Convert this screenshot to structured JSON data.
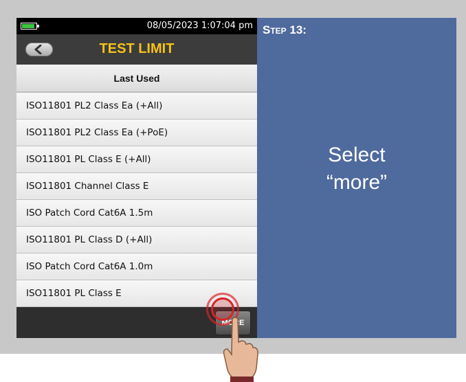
{
  "statusbar": {
    "datetime": "08/05/2023 1:07:04 pm",
    "battery_icon": "battery-icon"
  },
  "titlebar": {
    "title": "TEST LIMIT",
    "back_icon": "chevron-left-icon"
  },
  "group_header": "Last Used",
  "list": [
    "ISO11801 PL2 Class Ea (+All)",
    "ISO11801 PL2 Class Ea (+PoE)",
    "ISO11801 PL Class E (+All)",
    "ISO11801 Channel Class E",
    "ISO Patch Cord Cat6A 1.5m",
    "ISO11801 PL Class D (+All)",
    "ISO Patch Cord Cat6A 1.0m",
    "ISO11801 PL Class E"
  ],
  "bottombar": {
    "more_label": "MORE"
  },
  "panel": {
    "step": "Step 13:",
    "instruction_line1": "Select",
    "instruction_line2": "“more”"
  },
  "colors": {
    "title": "#f7c21a",
    "panel": "#4f6a9d",
    "tap_indicator": "#d9232a",
    "battery": "#3ec53e"
  }
}
